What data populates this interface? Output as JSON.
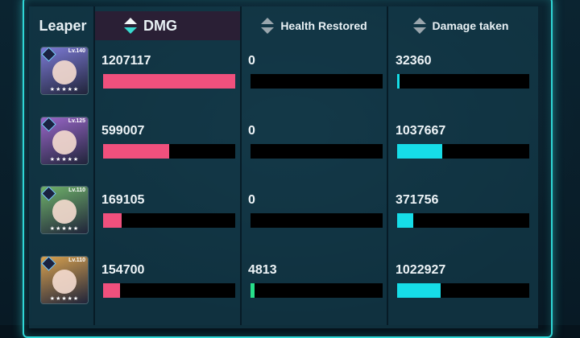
{
  "header": {
    "first_col": "Leaper",
    "columns": [
      {
        "label": "DMG",
        "icon": "sort-icon",
        "selected": true
      },
      {
        "label": "Health Restored",
        "icon": "sort-icon",
        "selected": false
      },
      {
        "label": "Damage taken",
        "icon": "sort-icon",
        "selected": false
      }
    ]
  },
  "colors": {
    "dmg": "#f0507d",
    "heal": "#27e08a",
    "taken": "#16dde8",
    "frame": "#2fd6d6"
  },
  "rows": [
    {
      "level": "Lv.140",
      "portrait_color": "#7d7bd6",
      "dmg": "1207117",
      "dmg_fill": 1.0,
      "heal": "0",
      "heal_fill": 0.0,
      "taken": "32360",
      "taken_fill": 0.02
    },
    {
      "level": "Lv.125",
      "portrait_color": "#9a67c9",
      "dmg": "599007",
      "dmg_fill": 0.5,
      "heal": "0",
      "heal_fill": 0.0,
      "taken": "1037667",
      "taken_fill": 0.34
    },
    {
      "level": "Lv.110",
      "portrait_color": "#6fb26a",
      "dmg": "169105",
      "dmg_fill": 0.14,
      "heal": "0",
      "heal_fill": 0.0,
      "taken": "371756",
      "taken_fill": 0.12
    },
    {
      "level": "Lv.110",
      "portrait_color": "#d9a24f",
      "dmg": "154700",
      "dmg_fill": 0.13,
      "heal": "4813",
      "heal_fill": 0.03,
      "taken": "1022927",
      "taken_fill": 0.33
    }
  ]
}
